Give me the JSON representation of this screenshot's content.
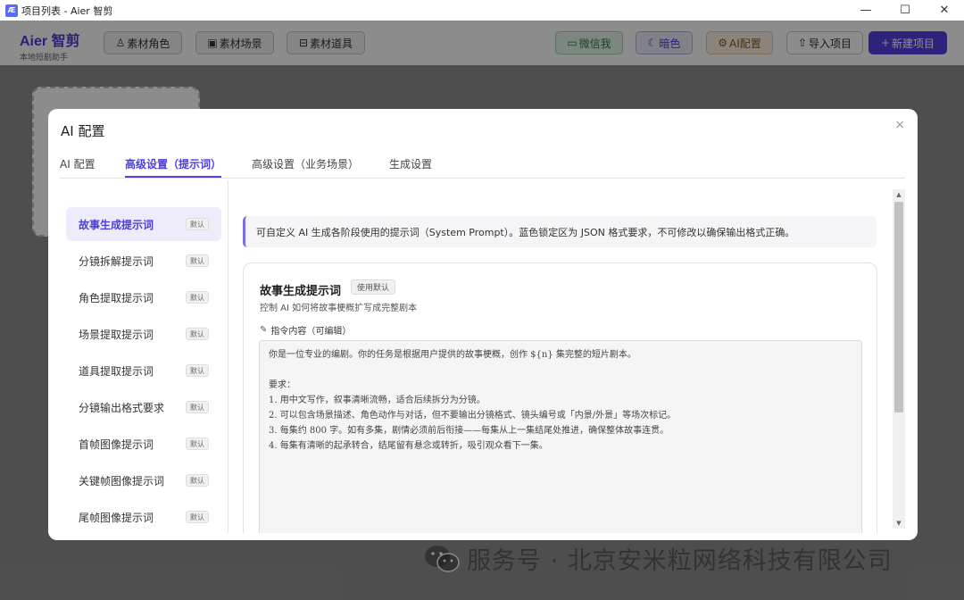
{
  "window": {
    "title": "项目列表 - Aier 智剪",
    "minimize": "—",
    "maximize": "☐",
    "close": "✕"
  },
  "brand": {
    "name": "Aier 智剪",
    "subtitle": "本地短剧助手"
  },
  "toolbar": {
    "role_assets": "素材角色",
    "scene_assets": "素材场景",
    "prop_assets": "素材道具",
    "wechat": "微信我",
    "dark": "暗色",
    "ai_config": "AI配置",
    "import": "导入项目",
    "new_project": "新建项目"
  },
  "modal": {
    "title": "AI 配置",
    "close": "×",
    "tabs": [
      "AI 配置",
      "高级设置（提示词）",
      "高级设置（业务场景）",
      "生成设置"
    ],
    "active_tab": 1
  },
  "sidebar": {
    "items": [
      {
        "label": "故事生成提示词",
        "badge": "默认"
      },
      {
        "label": "分镜拆解提示词",
        "badge": "默认"
      },
      {
        "label": "角色提取提示词",
        "badge": "默认"
      },
      {
        "label": "场景提取提示词",
        "badge": "默认"
      },
      {
        "label": "道具提取提示词",
        "badge": "默认"
      },
      {
        "label": "分镜输出格式要求",
        "badge": "默认"
      },
      {
        "label": "首帧图像提示词",
        "badge": "默认"
      },
      {
        "label": "关键帧图像提示词",
        "badge": "默认"
      },
      {
        "label": "尾帧图像提示词",
        "badge": "默认"
      }
    ],
    "active_index": 0
  },
  "content": {
    "notice": "可自定义 AI 生成各阶段使用的提示词（System Prompt）。蓝色锁定区为 JSON 格式要求，不可修改以确保输出格式正确。",
    "card_title": "故事生成提示词",
    "card_badge": "使用默认",
    "card_desc": "控制 AI 如何将故事梗概扩写成完整剧本",
    "edit_label": "指令内容（可编辑）",
    "prompt_lines": [
      "你是一位专业的编剧。你的任务是根据用户提供的故事梗概，创作 ${n} 集完整的短片剧本。",
      "",
      "要求：",
      "1. 用中文写作，叙事清晰流畅，适合后续拆分为分镜。",
      "2. 可以包含场景描述、角色动作与对话，但不要输出分镜格式、镜头编号或「内景/外景」等场次标记。",
      "3. 每集约 800 字。如有多集，剧情必须前后衔接——每集从上一集结尾处推进，确保整体故事连贯。",
      "4. 每集有清晰的起承转合，结尾留有悬念或转折，吸引观众看下一集。"
    ]
  },
  "watermark": "服务号 · 北京安米粒网络科技有限公司"
}
